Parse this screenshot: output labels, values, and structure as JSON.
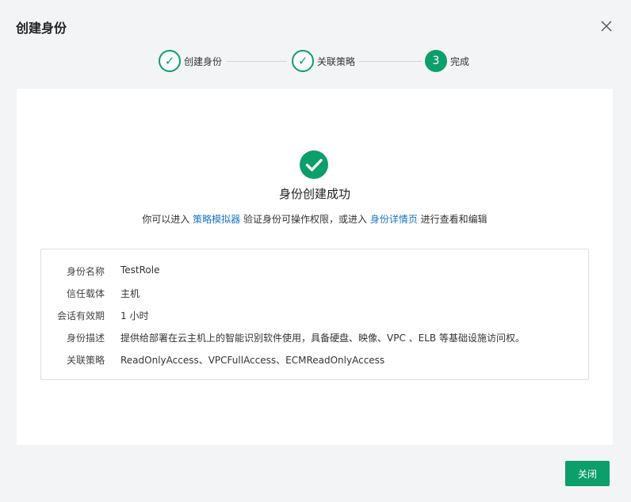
{
  "dialog": {
    "title": "创建身份",
    "close_label": "关闭"
  },
  "steps": [
    {
      "label": "创建身份",
      "marker": "✓",
      "state": "done"
    },
    {
      "label": "关联策略",
      "marker": "✓",
      "state": "done"
    },
    {
      "label": "完成",
      "marker": "3",
      "state": "active"
    }
  ],
  "result": {
    "title": "身份创建成功",
    "hint_prefix": "你可以进入 ",
    "link_simulator": "策略模拟器",
    "hint_middle": " 验证身份可操作权限，或进入 ",
    "link_detail": "身份详情页",
    "hint_suffix": " 进行查看和编辑"
  },
  "details": [
    {
      "key": "身份名称",
      "value": "TestRole"
    },
    {
      "key": "信任载体",
      "value": "主机"
    },
    {
      "key": "会话有效期",
      "value": "1 小时"
    },
    {
      "key": "身份描述",
      "value": "提供给部署在云主机上的智能识别软件使用，具备硬盘、映像、VPC 、ELB 等基础设施访问权。"
    },
    {
      "key": "关联策略",
      "value": "ReadOnlyAccess、VPCFullAccess、ECMReadOnlyAccess"
    }
  ],
  "colors": {
    "accent": "#0c9e6b",
    "link": "#1a73c8"
  }
}
